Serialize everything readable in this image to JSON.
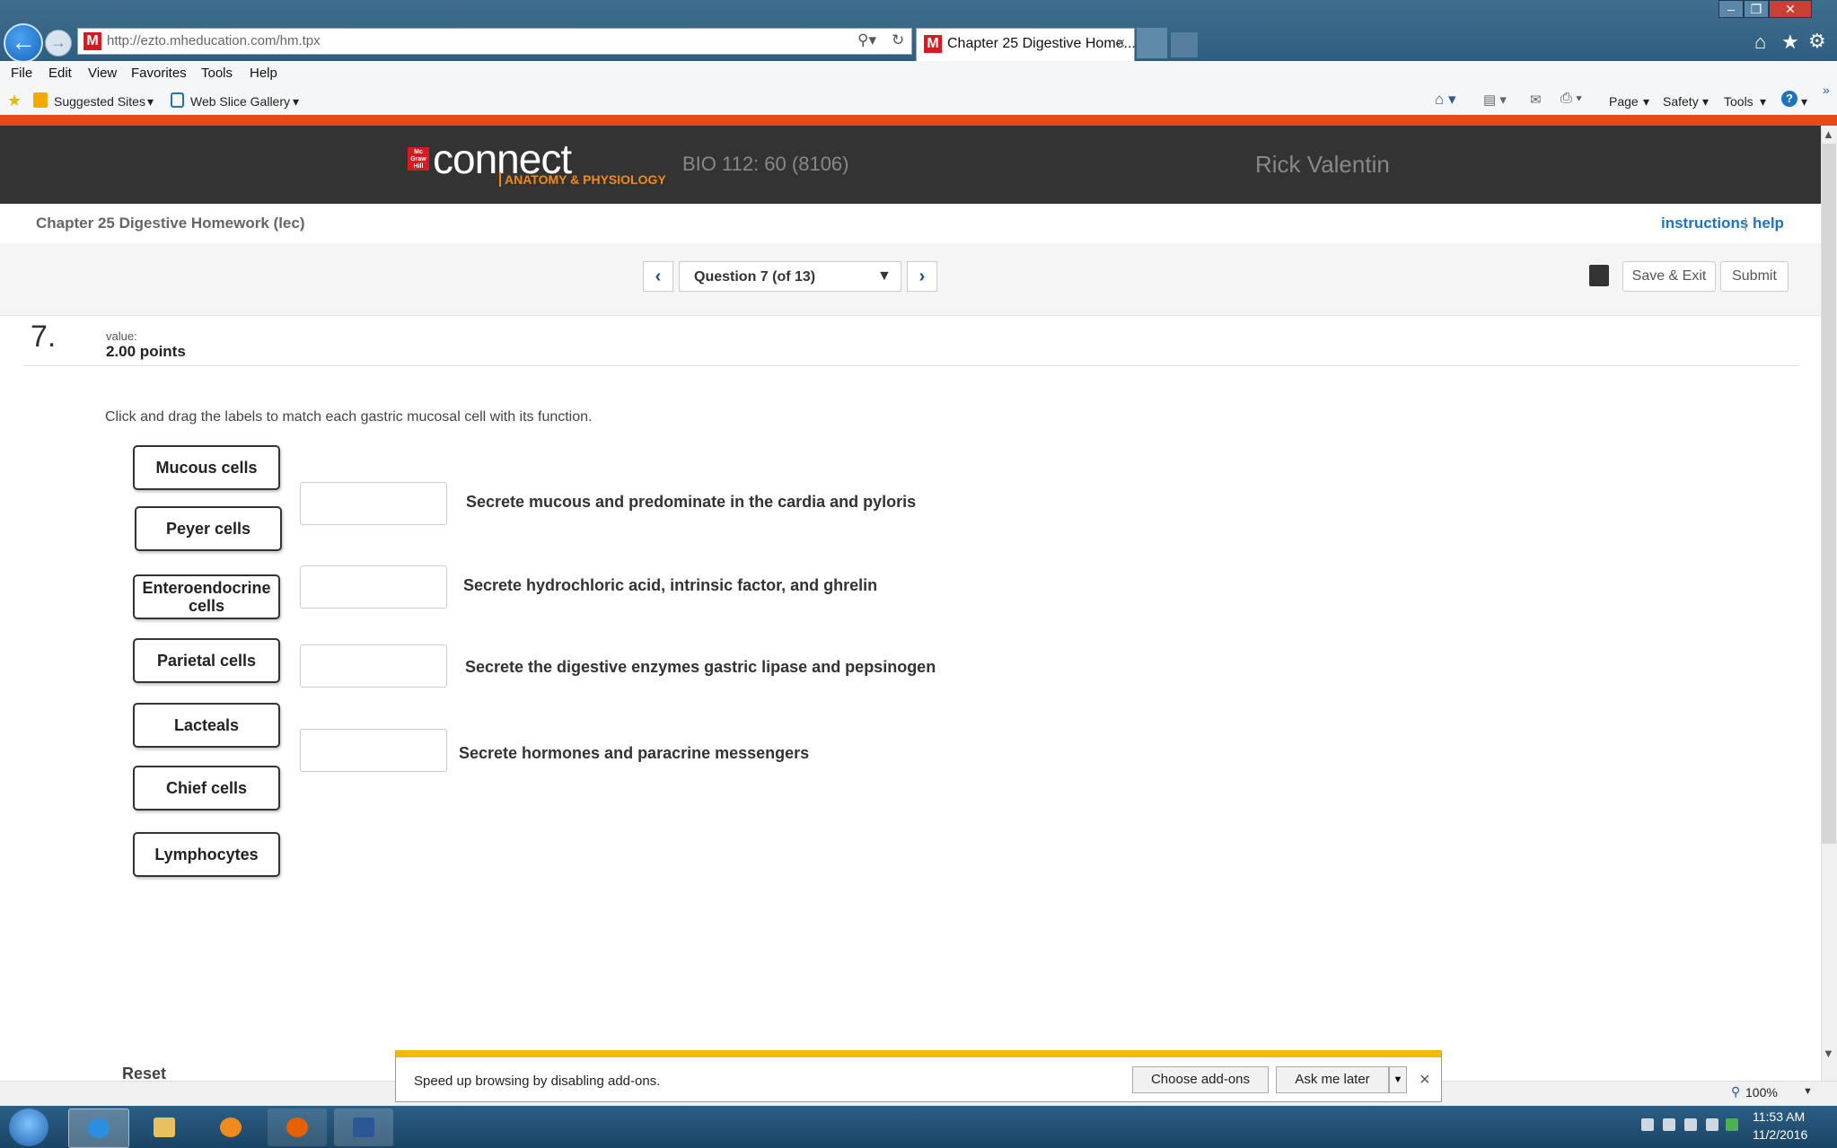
{
  "browser": {
    "url": "http://ezto.mheducation.com/hm.tpx",
    "tab_title": "Chapter 25 Digestive Home...",
    "menu": [
      "File",
      "Edit",
      "View",
      "Favorites",
      "Tools",
      "Help"
    ],
    "favorites": [
      "Suggested Sites",
      "Web Slice Gallery"
    ],
    "commands": [
      "Page",
      "Safety",
      "Tools"
    ],
    "zoom": "100%"
  },
  "header": {
    "logo_text": "connect",
    "logo_sub": "ANATOMY & PHYSIOLOGY",
    "course": "BIO 112: 60 (8106)",
    "user": "Rick Valentin"
  },
  "assignment": {
    "title": "Chapter 25 Digestive Homework (lec)",
    "instructions_link": "instructions",
    "separator": "|",
    "help_link": "help"
  },
  "navigation": {
    "question_label": "Question 7 (of 13)",
    "save_exit": "Save & Exit",
    "submit": "Submit"
  },
  "question": {
    "number": "7.",
    "value_label": "value:",
    "value": "2.00 points",
    "instructions": "Click and drag the labels to match each gastric mucosal cell with its function.",
    "labels": [
      "Mucous cells",
      "Peyer cells",
      "Enteroendocrine cells",
      "Parietal cells",
      "Lacteals",
      "Chief cells",
      "Lymphocytes"
    ],
    "functions": [
      "Secrete mucous and predominate in the cardia and pyloris",
      "Secrete hydrochloric acid, intrinsic factor, and ghrelin",
      "Secrete the digestive enzymes gastric lipase and pepsinogen",
      "Secrete hormones and paracrine messengers"
    ],
    "reset": "Reset"
  },
  "notification": {
    "text": "Speed up browsing by disabling add-ons.",
    "choose": "Choose add-ons",
    "later": "Ask me later"
  },
  "taskbar": {
    "time": "11:53 AM",
    "date": "11/2/2016"
  },
  "colors": {
    "header_bg": "#333333",
    "accent_orange": "#e84a16",
    "link_blue": "#1a74c8",
    "notif_yellow": "#f5b800"
  }
}
